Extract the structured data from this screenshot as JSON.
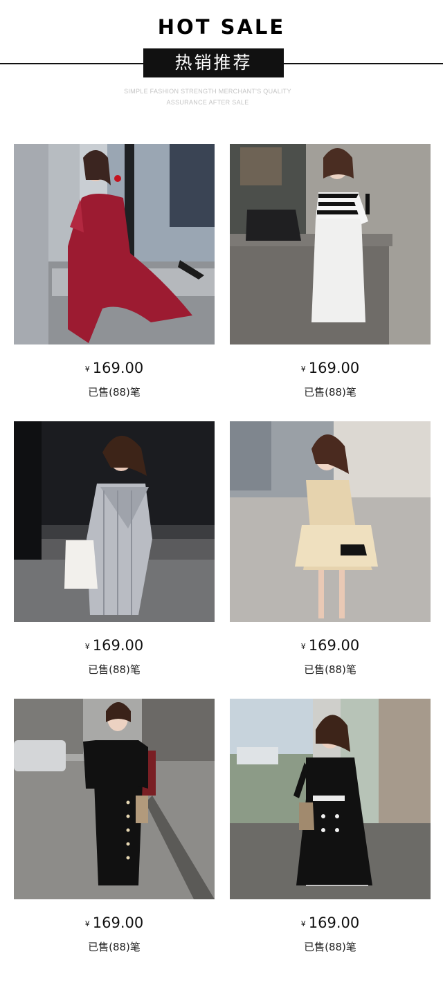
{
  "header": {
    "title": "HOT SALE",
    "subtitle_cn": "热销推荐",
    "tagline_line1": "SIMPLE FASHION STRENGTH MERCHANT'S QUALITY",
    "tagline_line2": "ASSURANCE AFTER SALE"
  },
  "products": [
    {
      "currency": "¥",
      "price": "169.00",
      "sold": "已售(88)笔"
    },
    {
      "currency": "¥",
      "price": "169.00",
      "sold": "已售(88)笔"
    },
    {
      "currency": "¥",
      "price": "169.00",
      "sold": "已售(88)笔"
    },
    {
      "currency": "¥",
      "price": "169.00",
      "sold": "已售(88)笔"
    },
    {
      "currency": "¥",
      "price": "169.00",
      "sold": "已售(88)笔"
    },
    {
      "currency": "¥",
      "price": "169.00",
      "sold": "已售(88)笔"
    }
  ]
}
